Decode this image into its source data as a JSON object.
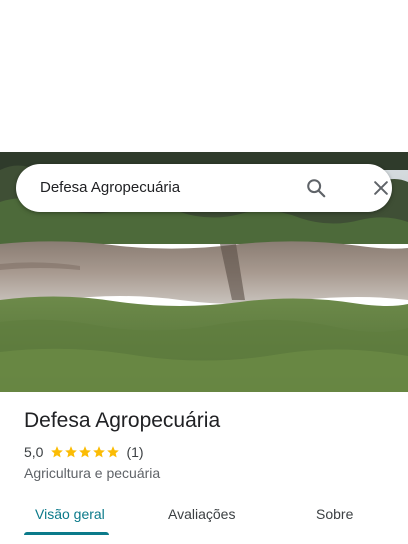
{
  "search": {
    "query": "Defesa Agropecuária"
  },
  "place": {
    "title": "Defesa Agropecuária",
    "rating_value": "5,0",
    "rating_stars": 5,
    "rating_count": "(1)",
    "category": "Agricultura e pecuária"
  },
  "tabs": [
    {
      "label": "Visão geral",
      "active": true
    },
    {
      "label": "Avaliações",
      "active": false
    },
    {
      "label": "Sobre",
      "active": false
    }
  ],
  "colors": {
    "accent": "#0b7a8a",
    "star": "#fbbc04"
  },
  "icons": {
    "search": "search-icon",
    "close": "close-icon"
  }
}
